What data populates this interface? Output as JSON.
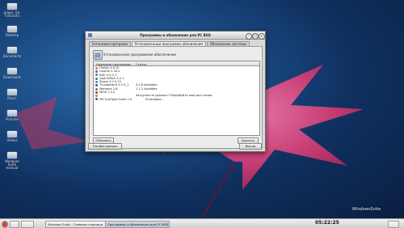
{
  "desktop": {
    "icons": [
      {
        "label": "grape, rte-hinkraif3",
        "icon": "folder-icon"
      },
      {
        "label": "Desktop",
        "icon": "folder-icon"
      },
      {
        "label": "Documents",
        "icon": "folder-icon"
      },
      {
        "label": "Downloads",
        "icon": "folder-icon"
      },
      {
        "label": "Music",
        "icon": "folder-icon"
      },
      {
        "label": "Pictures",
        "icon": "folder-icon"
      },
      {
        "label": "Videos",
        "icon": "folder-icon"
      },
      {
        "label": "Windows Suite manual",
        "icon": "folder-icon"
      }
    ],
    "watermark": "WindowsSuite"
  },
  "window": {
    "title": "Программы и обновления для PC BSD",
    "tabs": [
      "Установка программ",
      "Установленные программы обновления",
      "Обновление системы"
    ],
    "panel_label": "Установленное программное обеспечение",
    "columns": {
      "name": "Название программы",
      "status": "Статус"
    },
    "rows": [
      {
        "name": "Firefox 3.6.10",
        "status": "",
        "color": "#e0761f"
      },
      {
        "name": "Gnome 2.30.2",
        "status": "",
        "color": "#4c6fb2"
      },
      {
        "name": "KDE 4.5.3_1",
        "status": "",
        "color": "#3a7fd0"
      },
      {
        "name": "OpenOffice 3.2.1",
        "status": "",
        "color": "#2e8b57"
      },
      {
        "name": "Skype 2.0.0.72",
        "status": "",
        "color": "#1a9ae0"
      },
      {
        "name": "Thunderbird 3.0.5_1",
        "status": "3.1.6 Available",
        "color": "#3060a8"
      },
      {
        "name": "Warzone 1.8",
        "status": "1.1.2 Available",
        "color": "#8d6e2a"
      },
      {
        "name": "Wine 1.3.2",
        "status": "",
        "color": "#a83232"
      },
      {
        "name": "",
        "status": "Загрузка не удалась! Попробуйте ещё раз позже.",
        "color": "#888888"
      },
      {
        "name": "MS TrueType Fonts 1.0 ",
        "status": "Установка...",
        "color": "#555555"
      }
    ],
    "buttons": {
      "refresh": "Обновить",
      "remove": "Удалить",
      "configure": "Конфигурация",
      "close": "Выход"
    }
  },
  "taskbar": {
    "items": [
      "Windows Suite - Главная страница",
      "Программы и обновления для PC BSD"
    ],
    "clock": "05:22:25"
  },
  "colors": {
    "accent": "#3e6fb4",
    "leaf": "#d6437a"
  }
}
